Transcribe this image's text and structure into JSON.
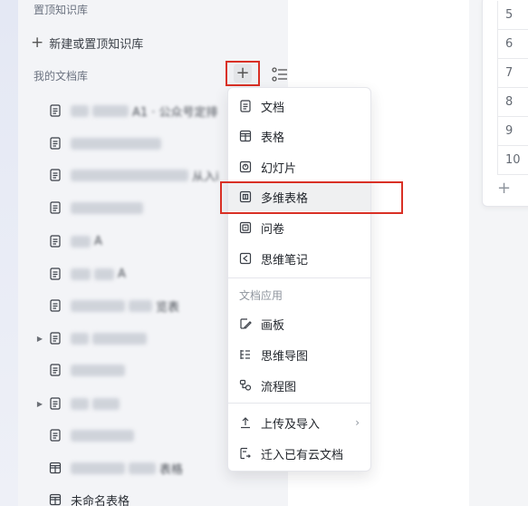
{
  "sidebar": {
    "header": "置顶知识库",
    "new_label": "新建或置顶知识库",
    "my_library": "我的文档库",
    "items": [
      {
        "text": "A1 · 公众号定排",
        "blurred": true,
        "expandable": false
      },
      {
        "text": "",
        "blurred": true,
        "expandable": false
      },
      {
        "text": "从入i",
        "blurred": true,
        "expandable": false
      },
      {
        "text": "",
        "blurred": true,
        "expandable": false
      },
      {
        "text": "A",
        "blurred": true,
        "expandable": false
      },
      {
        "text": "A",
        "blurred": true,
        "expandable": false
      },
      {
        "text": "览表",
        "blurred": true,
        "expandable": false
      },
      {
        "text": "",
        "blurred": true,
        "expandable": true
      },
      {
        "text": "",
        "blurred": true,
        "expandable": false
      },
      {
        "text": "",
        "blurred": true,
        "expandable": true
      },
      {
        "text": "",
        "blurred": true,
        "expandable": false
      },
      {
        "text": "表格",
        "blurred": true,
        "expandable": false
      },
      {
        "text": "未命名表格",
        "blurred": false,
        "expandable": false
      }
    ]
  },
  "menu": {
    "items": [
      {
        "label": "文档",
        "icon": "doc-icon"
      },
      {
        "label": "表格",
        "icon": "sheet-icon"
      },
      {
        "label": "幻灯片",
        "icon": "slides-icon"
      },
      {
        "label": "多维表格",
        "icon": "bitable-icon"
      },
      {
        "label": "问卷",
        "icon": "form-icon"
      },
      {
        "label": "思维笔记",
        "icon": "mindnote-icon"
      }
    ],
    "section_label": "文档应用",
    "apps": [
      {
        "label": "画板",
        "icon": "whiteboard-icon"
      },
      {
        "label": "思维导图",
        "icon": "mindmap-icon"
      },
      {
        "label": "流程图",
        "icon": "flowchart-icon"
      }
    ],
    "actions": [
      {
        "label": "上传及导入",
        "icon": "upload-icon"
      },
      {
        "label": "迁入已有云文档",
        "icon": "migrate-icon"
      }
    ]
  },
  "rows": [
    "5",
    "6",
    "7",
    "8",
    "9",
    "10"
  ],
  "colors": {
    "highlight": "#d93025"
  }
}
